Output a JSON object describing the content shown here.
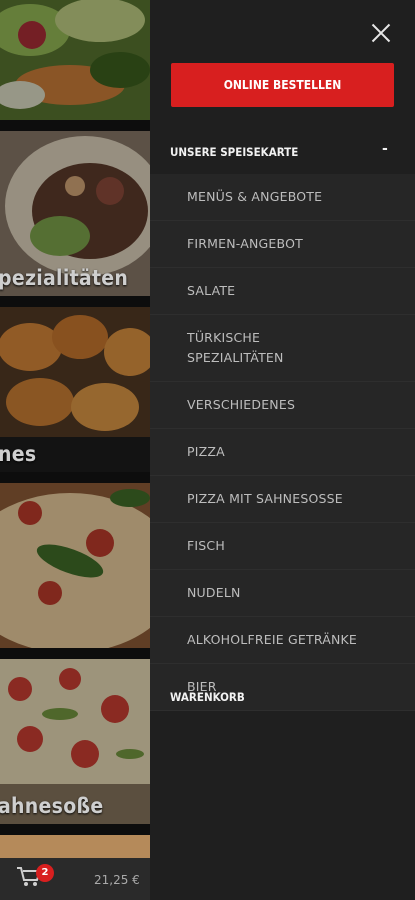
{
  "background_app": {
    "cards": [
      {
        "caption": ""
      },
      {
        "caption": "pezialitäten"
      },
      {
        "caption": "nes"
      },
      {
        "caption": ""
      },
      {
        "caption": "ahnesoße"
      }
    ],
    "cart_icon": "shopping-cart-icon",
    "cart_badge": "2",
    "cart_total": "21,25 €"
  },
  "drawer": {
    "close_icon": "close-icon",
    "order_button": "ONLINE BESTELLEN",
    "menu_section": {
      "label": "UNSERE SPEISEKARTE",
      "toggle": "-",
      "items": [
        "MENÜS & ANGEBOTE",
        "FIRMEN-ANGEBOT",
        "SALATE",
        "TÜRKISCHE SPEZIALITÄTEN",
        "VERSCHIEDENES",
        "PIZZA",
        "PIZZA MIT SAHNESOSSE",
        "FISCH",
        "NUDELN",
        "ALKOHOLFREIE GETRÄNKE",
        "BIER"
      ]
    },
    "cart_section": {
      "label": "WARENKORB"
    }
  },
  "colors": {
    "accent": "#d81f1f",
    "drawer_bg": "#1f1f1f",
    "submenu_bg": "#262626"
  }
}
